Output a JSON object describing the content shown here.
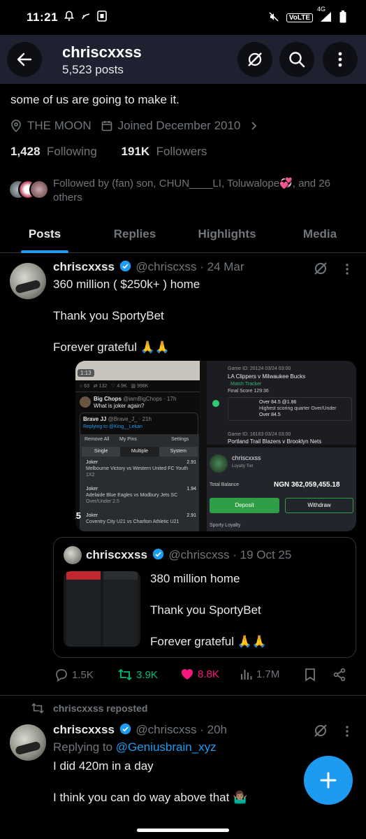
{
  "status_bar": {
    "time": "11:21",
    "volte": "VoLTE",
    "network": "4G"
  },
  "header": {
    "title": "chriscxxss",
    "posts_count": "5,523 posts"
  },
  "profile": {
    "bio": "some of us are going to make it.",
    "location": "THE MOON",
    "joined": "Joined December 2010",
    "following_count": "1,428",
    "following_label": "Following",
    "followers_count": "191K",
    "followers_label": "Followers",
    "followed_by": "Followed by (fan) son, CHUN____LI, Toluwalope💞, and 26 others"
  },
  "tabs": [
    "Posts",
    "Replies",
    "Highlights",
    "Media"
  ],
  "tweet1": {
    "name": "chriscxxss",
    "handle_date": "@chriscxss · 24 Mar",
    "line1": "360 million ( $250k+ ) home",
    "line2": "Thank you SportyBet",
    "line3": "Forever grateful 🙏🙏",
    "media": {
      "video_time": "1:13",
      "video_duration": "0:15",
      "quoted_tweet_name": "Big Chops",
      "quoted_tweet_handle": "@iamBigChops · 17h",
      "quoted_tweet_text": "What is joker again?",
      "reply_name": "Brave JJ",
      "reply_handle": "@Brave_J_ · 21h",
      "replying_to": "Replying to @King__Lekan",
      "remove_all": "Remove All",
      "my_pins": "My Pins",
      "settings": "Settings",
      "bet_tabs": [
        "Single",
        "Multiple",
        "System"
      ],
      "bets": [
        {
          "label": "Joker",
          "odds": "2.91",
          "match": "Melbourne Victory vs Western United FC Youth",
          "market": "1X2"
        },
        {
          "label": "Joker",
          "odds": "1.94",
          "match": "Adelaide Blue Eagles vs Modbury Jets SC",
          "market": "Over/Under 2.5"
        },
        {
          "label": "Joker",
          "odds": "2.91",
          "match": "Coventry City U21 vs Charlton Athletic U21",
          "market": ""
        }
      ],
      "game1_id": "Game ID: 20124  03/24 03:00",
      "game1_match": "LA Clippers v Milwaukee Bucks",
      "match_tracker": "Match Tracker",
      "final_score": "Final Score  129:36",
      "pick": "Over 84.5 @1.86",
      "market": "Highest scoring quarter  Over/Under",
      "outcome": "Over 84.5",
      "game2_id": "Game ID: 16163  03/24 03:00",
      "game2_match": "Portland Trail Blazers v Brooklyn Nets",
      "wallet_user": "chriscxxss",
      "loyalty_tier": "Loyalty Tier",
      "total_balance_label": "Total Balance",
      "balance": "NGN 362,059,455.18",
      "deposit": "Deposit",
      "withdraw": "Withdraw",
      "sporty_loyalty": "Sporty Loyalty"
    },
    "quote": {
      "name": "chriscxxss",
      "handle_date": "@chriscxss · 19 Oct 25",
      "line1": "380 million home",
      "line2": "Thank you SportyBet",
      "line3": "Forever grateful 🙏🙏"
    },
    "actions": {
      "replies": "1.5K",
      "reposts": "3.9K",
      "likes": "8.8K",
      "views": "1.7M"
    }
  },
  "tweet2": {
    "reposted_label": "chriscxxss reposted",
    "name": "chriscxxss",
    "handle_date": "@chriscxss · 20h",
    "replying_label": "Replying to",
    "replying_handle": "@Geniusbrain_xyz",
    "line1": "I did 420m in a day",
    "line2": "I think you can do way above that 🤷🏽‍♂️"
  },
  "colors": {
    "accent": "#1d9bf0",
    "repost_green": "#00ba7c",
    "like_pink": "#f91880",
    "header_bg": "#1e2230"
  }
}
